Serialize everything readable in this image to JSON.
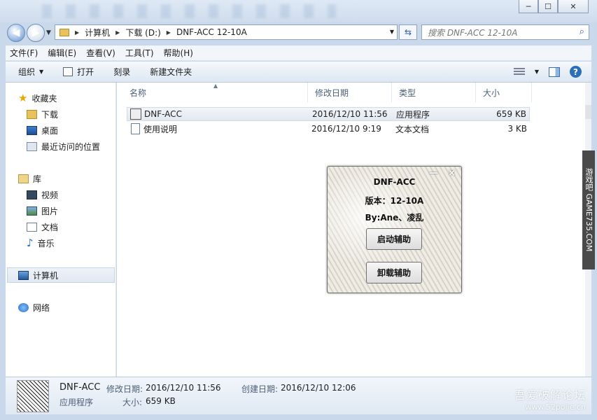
{
  "window": {
    "minimize_glyph": "─",
    "maximize_glyph": "☐",
    "close_glyph": "✕"
  },
  "address": {
    "crumbs": [
      "计算机",
      "下载 (D:)",
      "DNF-ACC  12-10A"
    ],
    "search_placeholder": "搜索 DNF-ACC  12-10A"
  },
  "menu": [
    "文件(F)",
    "编辑(E)",
    "查看(V)",
    "工具(T)",
    "帮助(H)"
  ],
  "toolbar": {
    "organize": "组织",
    "open": "打开",
    "burn": "刻录",
    "new_folder": "新建文件夹"
  },
  "nav": {
    "favorites": "收藏夹",
    "downloads": "下载",
    "desktop": "桌面",
    "recent": "最近访问的位置",
    "libraries": "库",
    "videos": "视频",
    "pictures": "图片",
    "documents": "文档",
    "music": "音乐",
    "computer": "计算机",
    "network": "网络"
  },
  "columns": {
    "name": "名称",
    "modified": "修改日期",
    "type": "类型",
    "size": "大小"
  },
  "files": [
    {
      "name": "DNF-ACC",
      "modified": "2016/12/10 11:56",
      "type": "应用程序",
      "size": "659 KB"
    },
    {
      "name": "使用说明",
      "modified": "2016/12/10 9:19",
      "type": "文本文档",
      "size": "3 KB"
    }
  ],
  "details": {
    "name": "DNF-ACC",
    "modified_label": "修改日期:",
    "modified": "2016/12/10 11:56",
    "created_label": "创建日期:",
    "created": "2016/12/10 12:06",
    "type": "应用程序",
    "size_label": "大小:",
    "size": "659 KB"
  },
  "watermark": {
    "line1": "吾爱破解论坛",
    "line2": "www.52pojie.cn"
  },
  "side_banner": "游戏吧 GAME735.COM",
  "dialog": {
    "title": "DNF-ACC",
    "version": "版本：12-10A",
    "author": "By:Ane、凌乱",
    "start_button": "启动辅助",
    "uninstall_button": "卸载辅助",
    "minimize_glyph": "—",
    "close_glyph": "×"
  }
}
